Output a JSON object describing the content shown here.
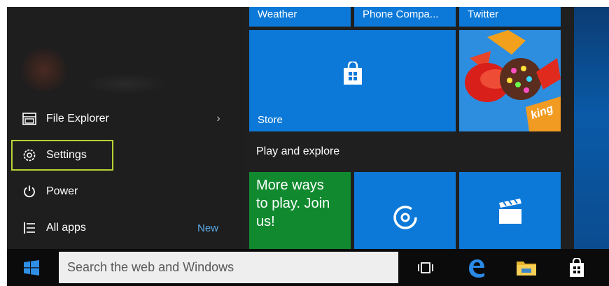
{
  "start_menu": {
    "left_items": [
      {
        "label": "File Explorer",
        "icon": "file-explorer-icon",
        "chevron": "›"
      },
      {
        "label": "Settings",
        "icon": "gear-icon",
        "highlight_color": "#b7d334"
      },
      {
        "label": "Power",
        "icon": "power-icon"
      },
      {
        "label": "All apps",
        "icon": "list-icon",
        "badge": "New"
      }
    ],
    "tiles_top": [
      {
        "name": "Weather"
      },
      {
        "name": "Phone Compa..."
      },
      {
        "name": "Twitter"
      }
    ],
    "tile_store": {
      "name": "Store",
      "icon": "store-bag-icon"
    },
    "tile_candy": {
      "icon": "candy-crush-icon",
      "logo_text": "king"
    },
    "section_title": "Play and explore",
    "tile_xbox": {
      "text": "More ways to play. Join us!"
    },
    "tile_groove": {
      "icon": "groove-music-icon"
    },
    "tile_movies": {
      "icon": "movies-clapper-icon"
    }
  },
  "taskbar": {
    "start_icon": "windows-logo-icon",
    "search_placeholder": "Search the web and Windows",
    "icons": [
      "task-view-icon",
      "edge-icon",
      "file-explorer-icon",
      "store-icon"
    ]
  },
  "colors": {
    "tile_blue": "#0c79d8",
    "tile_green": "#118a2f",
    "menu_bg": "#1f1f1f",
    "highlight": "#b7d334",
    "accent_text": "#5aa9e6"
  }
}
